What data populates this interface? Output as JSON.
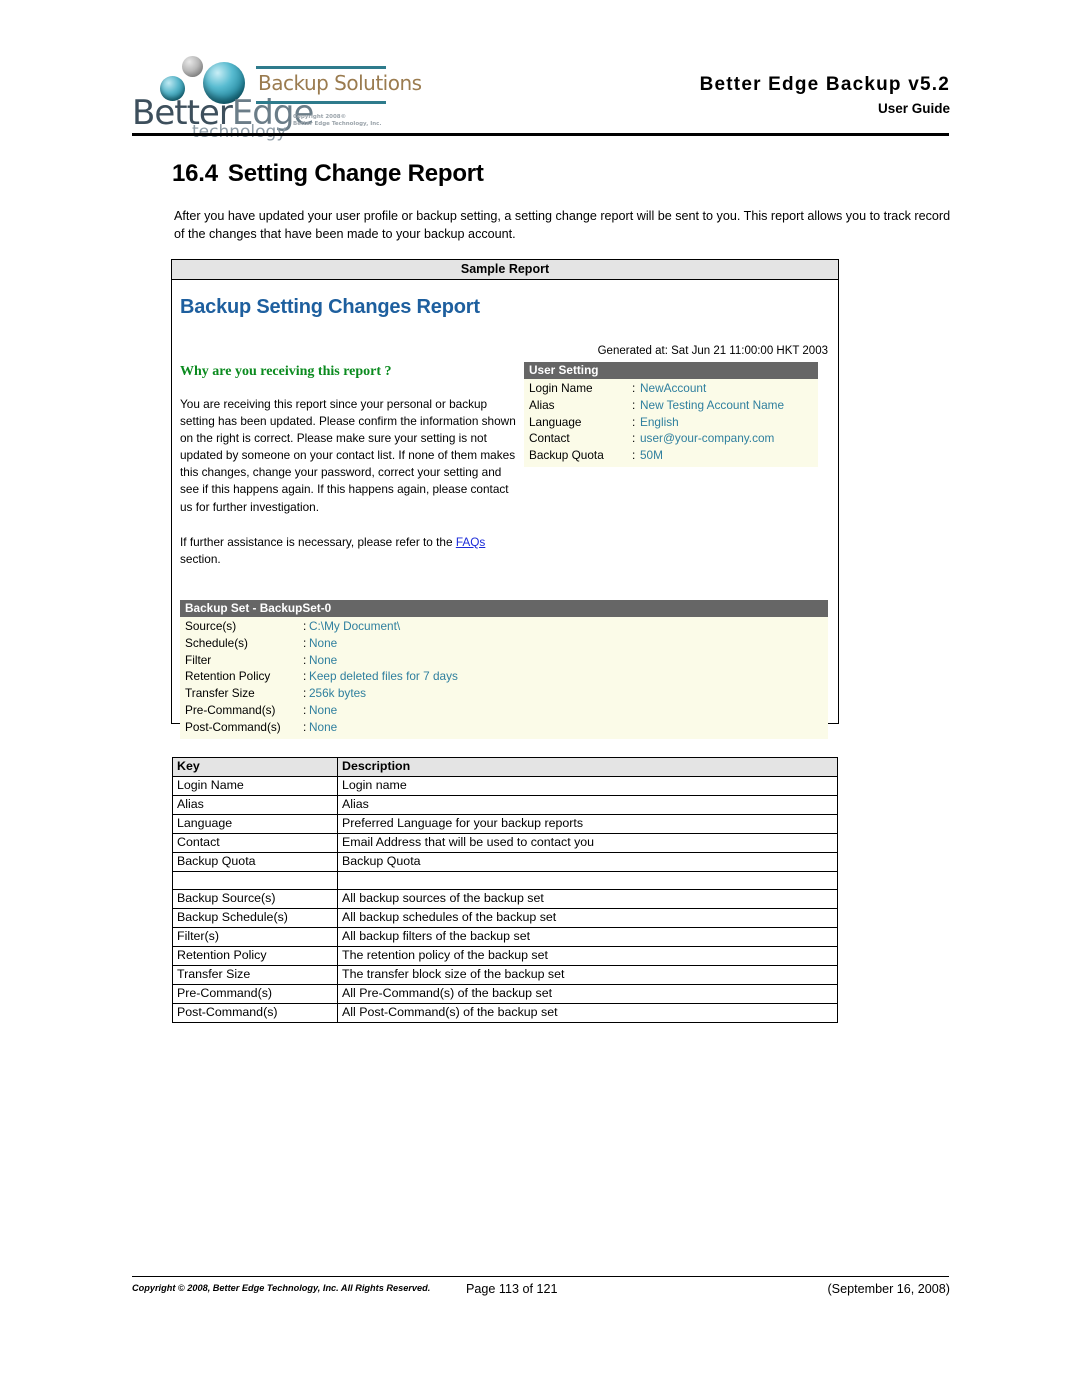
{
  "header": {
    "logo": {
      "wordmark_better": "Better",
      "wordmark_edge": "Edge",
      "tagline": "technology",
      "solutions": "Backup Solutions",
      "copyright_line1": "Copyright 2008©",
      "copyright_line2": "Better Edge Technology, Inc."
    },
    "title": "Better Edge Backup  v5.2",
    "subtitle": "User Guide"
  },
  "section": {
    "number": "16.4",
    "title": "Setting Change Report",
    "intro": "After you have updated your user profile or backup setting, a setting change report will be sent to you. This report allows you to track record of the changes that have been made to your backup account."
  },
  "sample_report": {
    "caption": "Sample Report",
    "report_title": "Backup Setting Changes Report",
    "generated_at": "Generated at: Sat Jun 21 11:00:00 HKT 2003",
    "why_heading": "Why are you receiving this report ?",
    "why_paragraph_1": "You are receiving this report since your personal or backup setting has been updated. Please confirm the information shown on the right is correct. Please make sure your setting is not updated by someone on your contact list. If none of them makes this changes, change your password, correct your setting and see if this happens again. If this happens again, please contact us for further investigation.",
    "why_paragraph_2_before": "If further assistance is necessary, please refer to the ",
    "why_link": "FAQs",
    "why_paragraph_2_after": " section.",
    "user_setting": {
      "header": "User Setting",
      "rows": [
        {
          "key": "Login Name",
          "sep": ":",
          "value": "NewAccount"
        },
        {
          "key": "Alias",
          "sep": ":",
          "value": "New Testing Account Name"
        },
        {
          "key": "Language",
          "sep": ":",
          "value": "English"
        },
        {
          "key": "Contact",
          "sep": ":",
          "value": "user@your-company.com"
        },
        {
          "key": "Backup Quota",
          "sep": ":",
          "value": "50M"
        }
      ]
    },
    "backup_set": {
      "header": "Backup Set - BackupSet-0",
      "rows": [
        {
          "key": "Source(s)",
          "sep": ":",
          "value": "C:\\My Document\\"
        },
        {
          "key": "Schedule(s)",
          "sep": ":",
          "value": "None"
        },
        {
          "key": "Filter",
          "sep": ":",
          "value": "None"
        },
        {
          "key": "Retention Policy",
          "sep": ":",
          "value": "Keep deleted files for 7 days"
        },
        {
          "key": "Transfer Size",
          "sep": ":",
          "value": "256k bytes"
        },
        {
          "key": "Pre-Command(s)",
          "sep": ":",
          "value": "None"
        },
        {
          "key": "Post-Command(s)",
          "sep": ":",
          "value": "None"
        }
      ]
    }
  },
  "key_table": {
    "columns": [
      "Key",
      "Description"
    ],
    "rows": [
      [
        "Login Name",
        "Login name"
      ],
      [
        "Alias",
        "Alias"
      ],
      [
        "Language",
        "Preferred Language for your backup reports"
      ],
      [
        "Contact",
        "Email Address that will be used to contact you"
      ],
      [
        "Backup Quota",
        "Backup Quota"
      ],
      [
        "",
        ""
      ],
      [
        "Backup Source(s)",
        "All backup sources of the backup set"
      ],
      [
        "Backup Schedule(s)",
        "All backup schedules of the backup set"
      ],
      [
        "Filter(s)",
        "All backup filters of the backup set"
      ],
      [
        "Retention Policy",
        "The retention policy of the backup set"
      ],
      [
        "Transfer Size",
        "The transfer block size of the backup set"
      ],
      [
        "Pre-Command(s)",
        "All Pre-Command(s) of the backup set"
      ],
      [
        "Post-Command(s)",
        "All Post-Command(s) of the backup set"
      ]
    ]
  },
  "footer": {
    "copyright": "Copyright © 2008, Better Edge Technology, Inc.   All Rights Reserved.",
    "page": "Page 113 of 121",
    "date": "(September 16, 2008)"
  },
  "colors": {
    "report_title": "#1e5f9e",
    "why_heading": "#0a8a1e",
    "panel_header_bg": "#666666",
    "panel_rows_bg": "#fbfbe8",
    "panel_value": "#2f7f9e",
    "link": "#1a2ad8",
    "table_header_bg": "#e4e4e4",
    "logo_teal": "#2e7b8c",
    "logo_gold": "#9a7b4f"
  }
}
